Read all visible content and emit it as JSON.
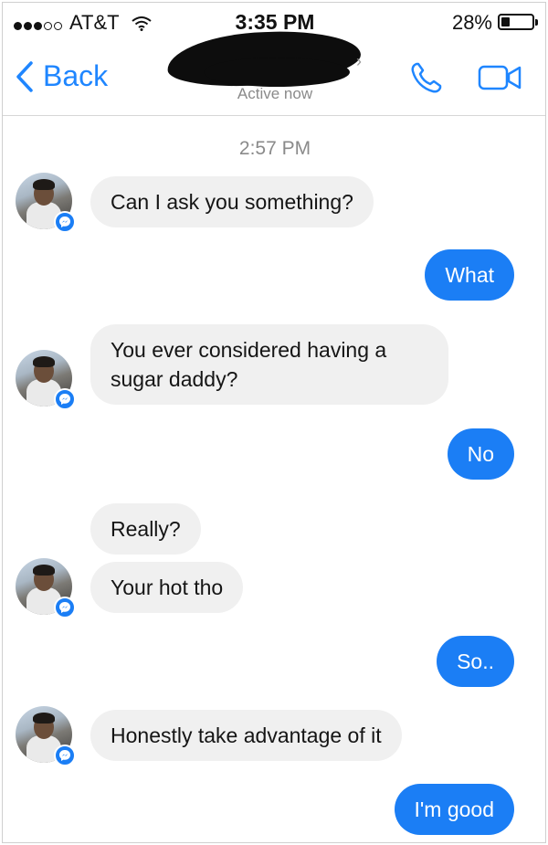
{
  "status_bar": {
    "carrier": "AT&T",
    "time": "3:35 PM",
    "battery_percent": "28%",
    "battery_level": 0.28
  },
  "nav": {
    "back_label": "Back",
    "contact_status": "Active now",
    "icons": [
      "chevron-left-icon",
      "phone-icon",
      "video-camera-icon"
    ],
    "accent_color": "#1f86ff"
  },
  "conversation": {
    "timestamp": "2:57 PM",
    "messages": [
      {
        "from": "them",
        "text": "Can I ask you something?"
      },
      {
        "from": "me",
        "text": "What"
      },
      {
        "from": "them",
        "text": "You ever considered having a sugar daddy?"
      },
      {
        "from": "me",
        "text": "No"
      },
      {
        "from": "them",
        "text": "Really?"
      },
      {
        "from": "them",
        "text": "Your hot tho"
      },
      {
        "from": "me",
        "text": "So.."
      },
      {
        "from": "them",
        "text": "Honestly take advantage of it"
      },
      {
        "from": "me",
        "text": "I'm good"
      }
    ]
  },
  "colors": {
    "outgoing_bubble": "#1b7ef5",
    "incoming_bubble": "#f0f0f0"
  }
}
